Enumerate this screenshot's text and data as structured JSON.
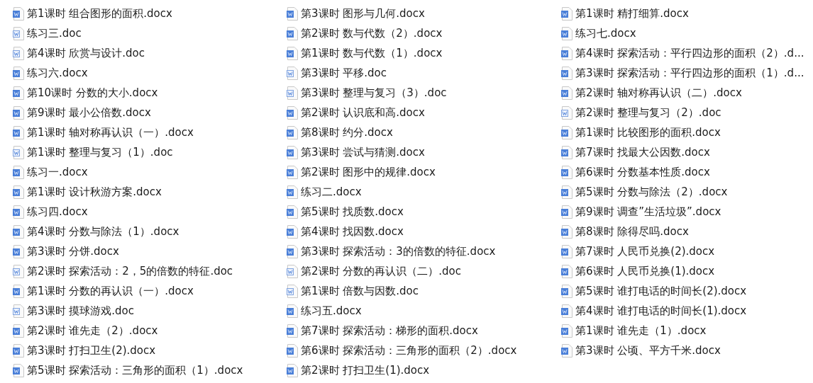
{
  "columns": [
    {
      "files": [
        {
          "name": "第1课时 组合图形的面积.docx",
          "kind": "docx"
        },
        {
          "name": "练习三.doc",
          "kind": "doc"
        },
        {
          "name": "第4课时 欣赏与设计.doc",
          "kind": "doc"
        },
        {
          "name": "练习六.docx",
          "kind": "docx"
        },
        {
          "name": "第10课时 分数的大小.docx",
          "kind": "docx"
        },
        {
          "name": "第9课时 最小公倍数.docx",
          "kind": "docx"
        },
        {
          "name": "第1课时 轴对称再认识（一）.docx",
          "kind": "docx"
        },
        {
          "name": "第1课时 整理与复习（1）.doc",
          "kind": "doc"
        },
        {
          "name": "练习一.docx",
          "kind": "docx"
        },
        {
          "name": "第1课时 设计秋游方案.docx",
          "kind": "docx"
        },
        {
          "name": "练习四.docx",
          "kind": "docx"
        },
        {
          "name": "第4课时 分数与除法（1）.docx",
          "kind": "docx"
        },
        {
          "name": "第3课时 分饼.docx",
          "kind": "docx"
        },
        {
          "name": "第2课时 探索活动：2，5的倍数的特征.doc",
          "kind": "doc"
        },
        {
          "name": "第1课时 分数的再认识（一）.docx",
          "kind": "docx"
        },
        {
          "name": "第3课时 摸球游戏.doc",
          "kind": "doc"
        },
        {
          "name": "第2课时 谁先走（2）.docx",
          "kind": "docx"
        },
        {
          "name": "第3课时 打扫卫生(2).docx",
          "kind": "docx"
        },
        {
          "name": "第5课时 探索活动：三角形的面积（1）.docx",
          "kind": "docx"
        }
      ]
    },
    {
      "files": [
        {
          "name": "第3课时 图形与几何.docx",
          "kind": "docx"
        },
        {
          "name": "第2课时 数与代数（2）.docx",
          "kind": "docx"
        },
        {
          "name": "第1课时 数与代数（1）.docx",
          "kind": "docx"
        },
        {
          "name": "第3课时 平移.doc",
          "kind": "doc"
        },
        {
          "name": "第3课时 整理与复习（3）.doc",
          "kind": "doc"
        },
        {
          "name": "第2课时 认识底和高.docx",
          "kind": "docx"
        },
        {
          "name": "第8课时 约分.docx",
          "kind": "docx"
        },
        {
          "name": "第3课时 尝试与猜测.docx",
          "kind": "docx"
        },
        {
          "name": "第2课时 图形中的规律.docx",
          "kind": "docx"
        },
        {
          "name": "练习二.docx",
          "kind": "docx"
        },
        {
          "name": "第5课时 找质数.docx",
          "kind": "docx"
        },
        {
          "name": "第4课时 找因数.docx",
          "kind": "docx"
        },
        {
          "name": "第3课时 探索活动：3的倍数的特征.docx",
          "kind": "docx"
        },
        {
          "name": "第2课时 分数的再认识（二）.doc",
          "kind": "doc"
        },
        {
          "name": "第1课时 倍数与因数.doc",
          "kind": "doc"
        },
        {
          "name": "练习五.docx",
          "kind": "docx"
        },
        {
          "name": "第7课时 探索活动：梯形的面积.docx",
          "kind": "docx"
        },
        {
          "name": "第6课时 探索活动：三角形的面积（2）.docx",
          "kind": "docx"
        },
        {
          "name": "第2课时 打扫卫生(1).docx",
          "kind": "docx"
        }
      ]
    },
    {
      "files": [
        {
          "name": "第1课时 精打细算.docx",
          "kind": "docx"
        },
        {
          "name": "练习七.docx",
          "kind": "docx"
        },
        {
          "name": "第4课时 探索活动：平行四边形的面积（2）.d...",
          "kind": "docx"
        },
        {
          "name": "第3课时 探索活动：平行四边形的面积（1）.d...",
          "kind": "docx"
        },
        {
          "name": "第2课时 轴对称再认识（二）.docx",
          "kind": "docx"
        },
        {
          "name": "第2课时 整理与复习（2）.doc",
          "kind": "doc"
        },
        {
          "name": "第1课时 比较图形的面积.docx",
          "kind": "docx"
        },
        {
          "name": "第7课时 找最大公因数.docx",
          "kind": "docx"
        },
        {
          "name": "第6课时 分数基本性质.docx",
          "kind": "docx"
        },
        {
          "name": "第5课时 分数与除法（2）.docx",
          "kind": "docx"
        },
        {
          "name": "第9课时 调查”生活垃圾”.docx",
          "kind": "docx"
        },
        {
          "name": "第8课时 除得尽吗.docx",
          "kind": "docx"
        },
        {
          "name": "第7课时 人民币兑换(2).docx",
          "kind": "docx"
        },
        {
          "name": "第6课时 人民币兑换(1).docx",
          "kind": "docx"
        },
        {
          "name": "第5课时 谁打电话的时间长(2).docx",
          "kind": "docx"
        },
        {
          "name": "第4课时 谁打电话的时间长(1).docx",
          "kind": "docx"
        },
        {
          "name": "第1课时 谁先走（1）.docx",
          "kind": "docx"
        },
        {
          "name": "第3课时 公顷、平方千米.docx",
          "kind": "docx"
        }
      ]
    }
  ]
}
